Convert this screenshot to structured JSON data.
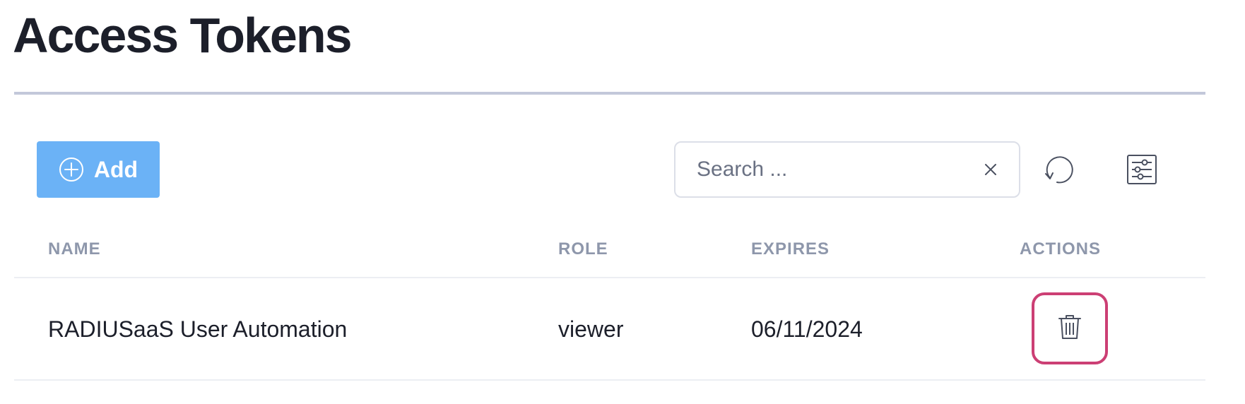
{
  "page": {
    "title": "Access Tokens"
  },
  "toolbar": {
    "add_label": "Add",
    "add_icon": "plus-circle-icon",
    "search_placeholder": "Search ...",
    "search_value": "",
    "clear_icon": "close-icon",
    "refresh_icon": "refresh-icon",
    "filter_icon": "filter-settings-icon"
  },
  "table": {
    "columns": [
      "NAME",
      "ROLE",
      "EXPIRES",
      "ACTIONS"
    ],
    "rows": [
      {
        "name": "RADIUSaaS User Automation",
        "role": "viewer",
        "expires": "06/11/2024",
        "action_icon": "trash-icon"
      }
    ]
  },
  "colors": {
    "accent": "#6bb2f6",
    "delete_outline": "#cc3f74",
    "header_text": "#8e97ab"
  }
}
